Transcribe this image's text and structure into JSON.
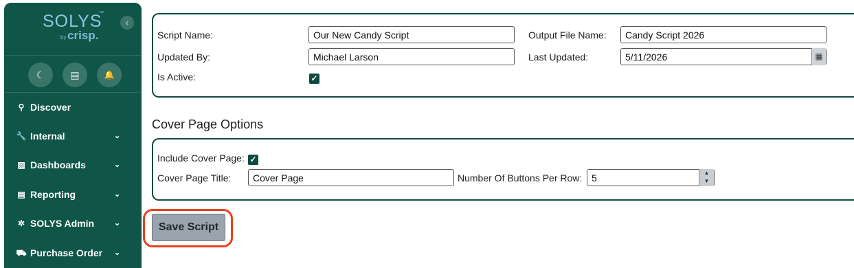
{
  "sidebar": {
    "logo": {
      "main": "SOLYS",
      "tm": "™",
      "by": "by",
      "crisp": "crisp."
    },
    "collapse_icon": "chevron-left-icon",
    "collapse_glyph": "‹",
    "quick_icons": [
      {
        "name": "moon-icon",
        "glyph": "☾"
      },
      {
        "name": "document-icon",
        "glyph": "▤"
      },
      {
        "name": "bell-icon",
        "glyph": "🔔"
      }
    ],
    "items": [
      {
        "label": "Discover",
        "icon": "search-icon",
        "glyph": "⚲",
        "chevron": ""
      },
      {
        "label": "Internal",
        "icon": "wrench-icon",
        "glyph": "🔧",
        "chevron": "⌄"
      },
      {
        "label": "Dashboards",
        "icon": "chart-icon",
        "glyph": "▨",
        "chevron": "⌄"
      },
      {
        "label": "Reporting",
        "icon": "report-icon",
        "glyph": "▤",
        "chevron": "⌄"
      },
      {
        "label": "SOLYS Admin",
        "icon": "gear-icon",
        "glyph": "✲",
        "chevron": "⌄"
      },
      {
        "label": "Purchase Order",
        "icon": "truck-icon",
        "glyph": "⛟",
        "chevron": "⌄"
      }
    ]
  },
  "script_form": {
    "script_name_label": "Script Name:",
    "script_name_value": "Our New Candy Script",
    "output_file_label": "Output File Name:",
    "output_file_value": "Candy Script 2026",
    "updated_by_label": "Updated By:",
    "updated_by_value": "Michael Larson",
    "last_updated_label": "Last Updated:",
    "last_updated_value": "5/11/2026",
    "is_active_label": "Is Active:",
    "is_active_checked": true
  },
  "cover_page": {
    "section_title": "Cover Page Options",
    "include_label": "Include Cover Page:",
    "include_checked": true,
    "title_label": "Cover Page Title:",
    "title_value": "Cover Page",
    "buttons_per_row_label": "Number Of Buttons Per Row:",
    "buttons_per_row_value": "5"
  },
  "actions": {
    "save_label": "Save Script"
  },
  "colors": {
    "sidebar": "#0f5548",
    "accent": "#0f4a40",
    "highlight": "#e8411c",
    "save_button": "#9aa4ae"
  }
}
